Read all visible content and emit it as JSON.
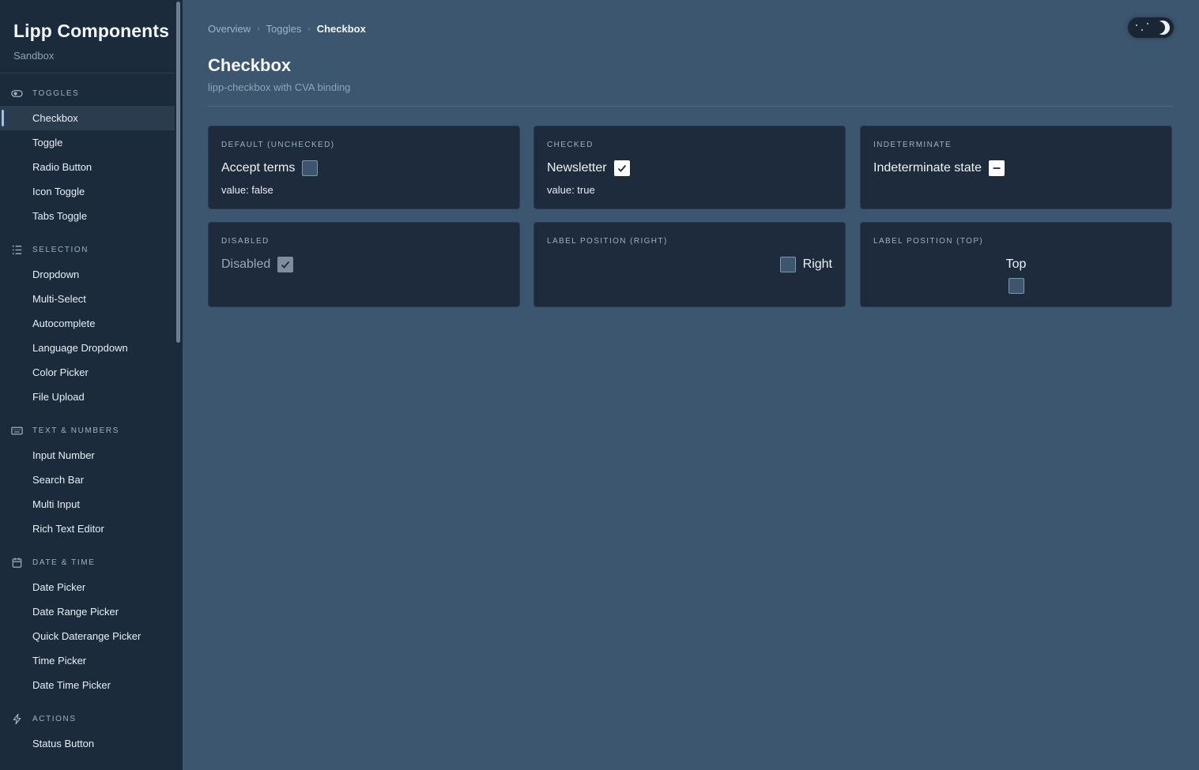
{
  "sidebar": {
    "title": "Lipp Components",
    "subtitle": "Sandbox",
    "sections": [
      {
        "heading": "TOGGLES",
        "icon": "toggle-icon",
        "items": [
          "Checkbox",
          "Toggle",
          "Radio Button",
          "Icon Toggle",
          "Tabs Toggle"
        ]
      },
      {
        "heading": "SELECTION",
        "icon": "list-icon",
        "items": [
          "Dropdown",
          "Multi-Select",
          "Autocomplete",
          "Language Dropdown",
          "Color Picker",
          "File Upload"
        ]
      },
      {
        "heading": "TEXT & NUMBERS",
        "icon": "keyboard-icon",
        "items": [
          "Input Number",
          "Search Bar",
          "Multi Input",
          "Rich Text Editor"
        ]
      },
      {
        "heading": "DATE & TIME",
        "icon": "calendar-icon",
        "items": [
          "Date Picker",
          "Date Range Picker",
          "Quick Daterange Picker",
          "Time Picker",
          "Date Time Picker"
        ]
      },
      {
        "heading": "ACTIONS",
        "icon": "bolt-icon",
        "items": [
          "Status Button"
        ]
      }
    ],
    "active_item": "Checkbox"
  },
  "breadcrumb": [
    "Overview",
    "Toggles",
    "Checkbox"
  ],
  "header": {
    "title": "Checkbox",
    "subtitle": "lipp-checkbox with CVA binding"
  },
  "theme_toggle": {
    "icon": "moon-icon",
    "state": "dark"
  },
  "cards": {
    "default": {
      "title": "DEFAULT (UNCHECKED)",
      "label": "Accept terms",
      "value": "value: false",
      "state": "unchecked"
    },
    "checked": {
      "title": "CHECKED",
      "label": "Newsletter",
      "value": "value: true",
      "state": "checked"
    },
    "indeterminate": {
      "title": "INDETERMINATE",
      "label": "Indeterminate state",
      "state": "indeterminate"
    },
    "disabled": {
      "title": "DISABLED",
      "label": "Disabled",
      "state": "checked-disabled"
    },
    "label_right": {
      "title": "LABEL POSITION (RIGHT)",
      "label": "Right",
      "state": "unchecked"
    },
    "label_top": {
      "title": "LABEL POSITION (TOP)",
      "label": "Top",
      "state": "unchecked"
    }
  },
  "colors": {
    "page_bg": "#3c5670",
    "sidebar_bg": "#1c2b3c",
    "card_bg": "#1d2b3c",
    "accent": "#9cc2e6"
  }
}
